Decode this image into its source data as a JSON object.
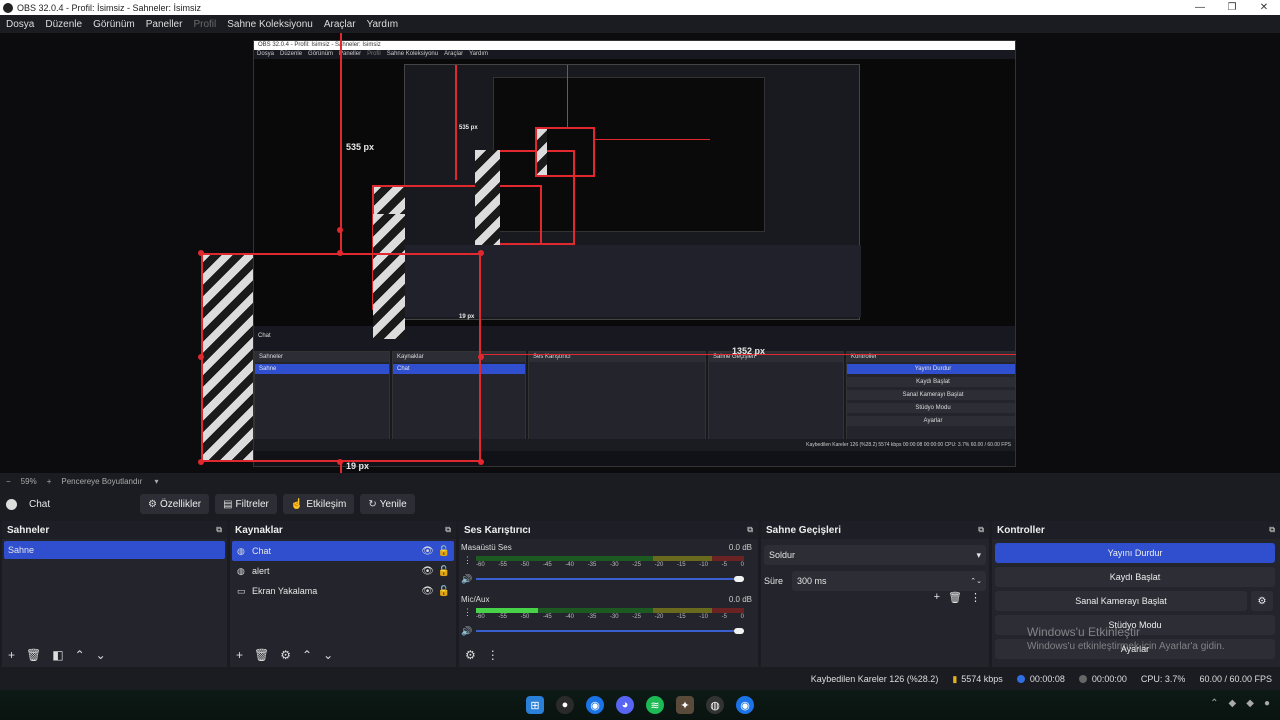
{
  "window": {
    "title": "OBS 32.0.4 - Profil: İsimsiz - Sahneler: İsimsiz",
    "controls": [
      "—",
      "❐",
      "✕"
    ]
  },
  "menu": [
    {
      "label": "Dosya",
      "disabled": false
    },
    {
      "label": "Düzenle",
      "disabled": false
    },
    {
      "label": "Görünüm",
      "disabled": false
    },
    {
      "label": "Paneller",
      "disabled": false
    },
    {
      "label": "Profil",
      "disabled": true
    },
    {
      "label": "Sahne Koleksiyonu",
      "disabled": false
    },
    {
      "label": "Araçlar",
      "disabled": false
    },
    {
      "label": "Yardım",
      "disabled": false
    }
  ],
  "preview": {
    "measure_top": "535 px",
    "measure_right": "1352 px",
    "measure_bottom": "19 px",
    "nested": {
      "title": "OBS 32.0.4 - Profil: İsimsiz - Sahneler: İsimsiz",
      "menu": [
        "Dosya",
        "Düzenle",
        "Görünüm",
        "Paneller",
        "Profil",
        "Sahne Koleksiyonu",
        "Araçlar",
        "Yardım"
      ],
      "measure_top": "535 px",
      "measure_bottom": "19 px",
      "source": "Chat",
      "docks": [
        "Sahneler",
        "Kaynaklar",
        "Ses Karıştırıcı",
        "Sahne Geçişleri",
        "Kontroller"
      ],
      "scene": "Sahne",
      "buttons": [
        "Yayını Durdur",
        "Kaydı Başlat",
        "Sanal Kamerayı Başlat",
        "Stüdyo Modu",
        "Ayarlar"
      ],
      "status": "Kaybedilen Kareler 126 (%28.2)   5574 kbps   00:00:08   00:00:00   CPU: 3.7%   60.00 / 60.00 FPS"
    }
  },
  "zoom": {
    "minus": "−",
    "value": "59%",
    "plus": "+",
    "mode": "Pencereye Boyutlandır"
  },
  "source_toolbar": {
    "source_name": "Chat",
    "buttons": [
      {
        "icon": "⚙",
        "label": "Özellikler"
      },
      {
        "icon": "▤",
        "label": "Filtreler"
      },
      {
        "icon": "☝",
        "label": "Etkileşim"
      },
      {
        "icon": "↻",
        "label": "Yenile"
      }
    ]
  },
  "scenes": {
    "title": "Sahneler",
    "items": [
      "Sahne"
    ]
  },
  "sources": {
    "title": "Kaynaklar",
    "items": [
      {
        "label": "Chat",
        "icon": "◍",
        "selected": true
      },
      {
        "label": "alert",
        "icon": "◍",
        "selected": false
      },
      {
        "label": "Ekran Yakalama",
        "icon": "▭",
        "selected": false
      }
    ]
  },
  "mixer": {
    "title": "Ses Karıştırıcı",
    "channels": [
      {
        "name": "Masaüstü Ses",
        "db": "0.0 dB",
        "level": 0.0,
        "volume": 1.0
      },
      {
        "name": "Mic/Aux",
        "db": "0.0 dB",
        "level": 0.23,
        "volume": 1.0
      }
    ],
    "ticks": [
      "-60",
      "-55",
      "-50",
      "-45",
      "-40",
      "-35",
      "-30",
      "-25",
      "-20",
      "-15",
      "-10",
      "-5",
      "0"
    ]
  },
  "transitions": {
    "title": "Sahne Geçişleri",
    "selected": "Soldur",
    "duration_label": "Süre",
    "duration_value": "300 ms"
  },
  "controls": {
    "title": "Kontroller",
    "stream": "Yayını Durdur",
    "record": "Kaydı Başlat",
    "virtualcam": "Sanal Kamerayı Başlat",
    "studio": "Stüdyo Modu",
    "settings": "Ayarlar"
  },
  "watermark": {
    "line1": "Windows'u Etkinleştir",
    "line2": "Windows'u etkinleştirmek için Ayarlar'a gidin."
  },
  "status": {
    "dropped": "Kaybedilen Kareler 126 (%28.2)",
    "bitrate": "5574 kbps",
    "stream_time": "00:00:08",
    "record_time": "00:00:00",
    "cpu": "CPU: 3.7%",
    "fps": "60.00 / 60.00 FPS"
  },
  "colors": {
    "accent": "#2f4fcf",
    "red": "#e0282e",
    "bg": "#1b1c22",
    "dock": "#24252c"
  }
}
